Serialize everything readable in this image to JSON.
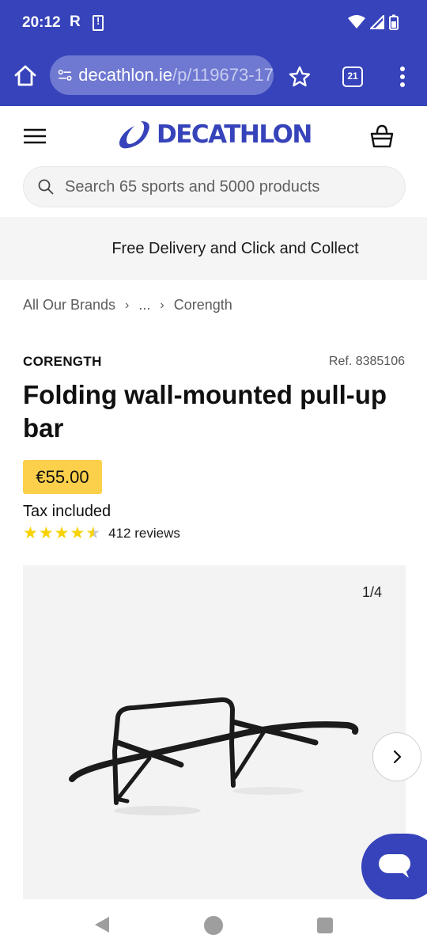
{
  "status_bar": {
    "time": "20:12",
    "indicator": "R"
  },
  "browser": {
    "url_domain": "decathlon.ie",
    "url_path": "/p/119673-17",
    "tab_count": "21"
  },
  "header": {
    "logo_text": "DECATHLON"
  },
  "search": {
    "placeholder": "Search 65 sports and 5000 products"
  },
  "promo": {
    "text": "Free Delivery and Click and Collect"
  },
  "breadcrumb": {
    "items": [
      "All Our Brands",
      "...",
      "Corength"
    ]
  },
  "product": {
    "brand": "CORENGTH",
    "ref": "Ref. 8385106",
    "title": "Folding wall-mounted pull-up bar",
    "price": "€55.00",
    "tax_note": "Tax included",
    "rating": 4.5,
    "reviews": "412 reviews"
  },
  "gallery": {
    "counter": "1/4"
  },
  "colors": {
    "brand_blue": "#3643ba",
    "price_yellow": "#fcd04a",
    "star_yellow": "#f7d200"
  }
}
